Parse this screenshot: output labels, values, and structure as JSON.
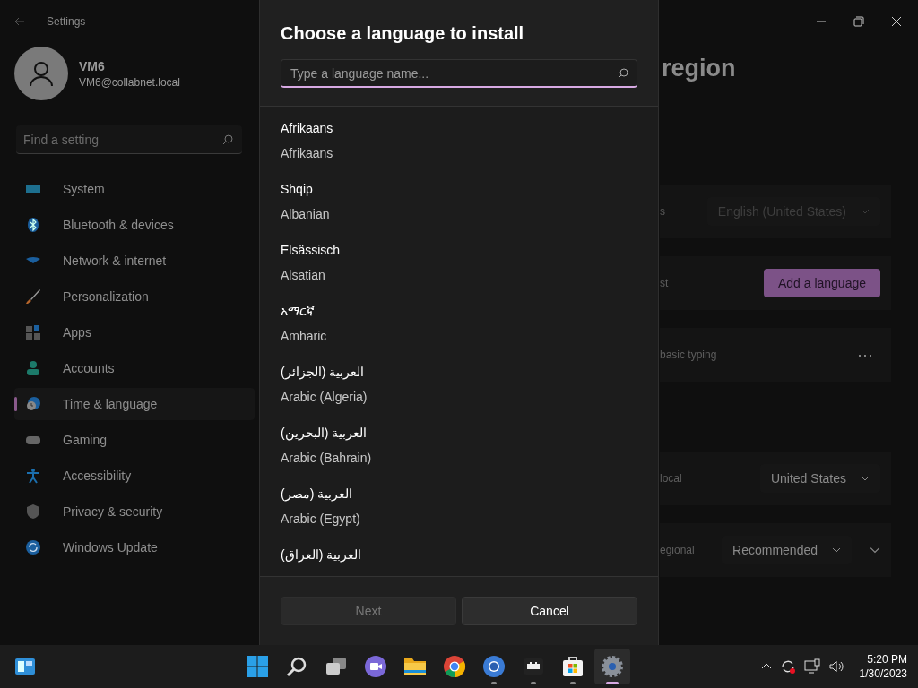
{
  "window": {
    "title": "Settings"
  },
  "user": {
    "name": "VM6",
    "email": "VM6@collabnet.local"
  },
  "search": {
    "placeholder": "Find a setting"
  },
  "nav": [
    {
      "kind": "system",
      "label": "System",
      "selected": false
    },
    {
      "kind": "bluetooth",
      "label": "Bluetooth & devices",
      "selected": false
    },
    {
      "kind": "network",
      "label": "Network & internet",
      "selected": false
    },
    {
      "kind": "brush",
      "label": "Personalization",
      "selected": false
    },
    {
      "kind": "apps",
      "label": "Apps",
      "selected": false
    },
    {
      "kind": "accounts",
      "label": "Accounts",
      "selected": false
    },
    {
      "kind": "time",
      "label": "Time & language",
      "selected": true
    },
    {
      "kind": "gaming",
      "label": "Gaming",
      "selected": false
    },
    {
      "kind": "accessibility",
      "label": "Accessibility",
      "selected": false
    },
    {
      "kind": "shield",
      "label": "Privacy & security",
      "selected": false
    },
    {
      "kind": "update",
      "label": "Windows Update",
      "selected": false
    }
  ],
  "page": {
    "title": "region",
    "groups": [
      {
        "rows": [
          {
            "label": "s",
            "kind": "dropdown",
            "value": "English (United States)",
            "disabled": true
          },
          {
            "label": "st",
            "kind": "accent-button",
            "value": "Add a language",
            "disabled": false
          },
          {
            "label": "basic typing",
            "kind": "more",
            "value": "⋯",
            "disabled": false
          }
        ]
      },
      {
        "rows": [
          {
            "label": "local",
            "kind": "dropdown",
            "value": "United States",
            "disabled": false
          },
          {
            "label": "egional",
            "kind": "dropdown-expand",
            "value": "Recommended",
            "disabled": false
          }
        ]
      }
    ]
  },
  "dialog": {
    "title": "Choose a language to install",
    "search": {
      "placeholder": "Type a language name..."
    },
    "languages": [
      {
        "native": "Afrikaans",
        "english": "Afrikaans"
      },
      {
        "native": "Shqip",
        "english": "Albanian"
      },
      {
        "native": "Elsässisch",
        "english": "Alsatian"
      },
      {
        "native": "አማርኛ",
        "english": "Amharic"
      },
      {
        "native": "العربية (الجزائر)",
        "english": "Arabic (Algeria)"
      },
      {
        "native": "العربية (البحرين)",
        "english": "Arabic (Bahrain)"
      },
      {
        "native": "العربية (مصر)",
        "english": "Arabic (Egypt)"
      },
      {
        "native": "العربية (العراق)"
      }
    ],
    "buttons": [
      {
        "label": "Next",
        "disabled": true
      },
      {
        "label": "Cancel",
        "disabled": false
      }
    ]
  },
  "taskbar": {
    "apps": [
      {
        "kind": "start",
        "running": false
      },
      {
        "kind": "search",
        "running": false
      },
      {
        "kind": "taskview",
        "running": false
      },
      {
        "kind": "chat",
        "running": false
      },
      {
        "kind": "folder",
        "running": false
      },
      {
        "kind": "chrome",
        "running": false
      },
      {
        "kind": "chrome-blue",
        "running": true
      },
      {
        "kind": "game",
        "running": true
      },
      {
        "kind": "store",
        "running": true
      },
      {
        "kind": "settings",
        "running": true,
        "selected": true
      }
    ],
    "time": "5:20 PM",
    "date": "1/30/2023"
  }
}
